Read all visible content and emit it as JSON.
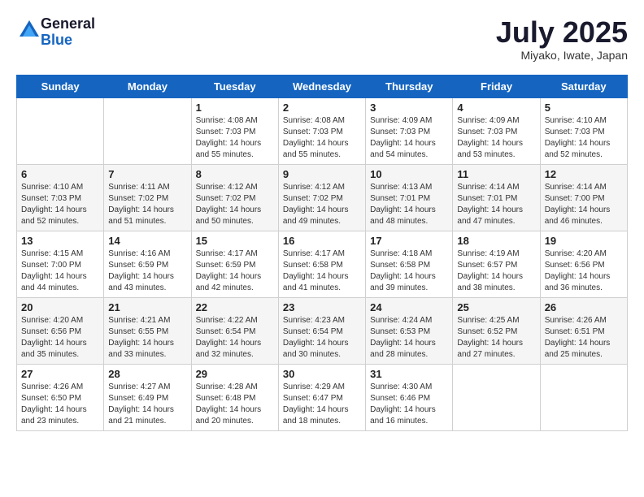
{
  "logo": {
    "general": "General",
    "blue": "Blue"
  },
  "title": "July 2025",
  "subtitle": "Miyako, Iwate, Japan",
  "headers": [
    "Sunday",
    "Monday",
    "Tuesday",
    "Wednesday",
    "Thursday",
    "Friday",
    "Saturday"
  ],
  "weeks": [
    [
      {
        "day": "",
        "sunrise": "",
        "sunset": "",
        "daylight": ""
      },
      {
        "day": "",
        "sunrise": "",
        "sunset": "",
        "daylight": ""
      },
      {
        "day": "1",
        "sunrise": "Sunrise: 4:08 AM",
        "sunset": "Sunset: 7:03 PM",
        "daylight": "Daylight: 14 hours and 55 minutes."
      },
      {
        "day": "2",
        "sunrise": "Sunrise: 4:08 AM",
        "sunset": "Sunset: 7:03 PM",
        "daylight": "Daylight: 14 hours and 55 minutes."
      },
      {
        "day": "3",
        "sunrise": "Sunrise: 4:09 AM",
        "sunset": "Sunset: 7:03 PM",
        "daylight": "Daylight: 14 hours and 54 minutes."
      },
      {
        "day": "4",
        "sunrise": "Sunrise: 4:09 AM",
        "sunset": "Sunset: 7:03 PM",
        "daylight": "Daylight: 14 hours and 53 minutes."
      },
      {
        "day": "5",
        "sunrise": "Sunrise: 4:10 AM",
        "sunset": "Sunset: 7:03 PM",
        "daylight": "Daylight: 14 hours and 52 minutes."
      }
    ],
    [
      {
        "day": "6",
        "sunrise": "Sunrise: 4:10 AM",
        "sunset": "Sunset: 7:03 PM",
        "daylight": "Daylight: 14 hours and 52 minutes."
      },
      {
        "day": "7",
        "sunrise": "Sunrise: 4:11 AM",
        "sunset": "Sunset: 7:02 PM",
        "daylight": "Daylight: 14 hours and 51 minutes."
      },
      {
        "day": "8",
        "sunrise": "Sunrise: 4:12 AM",
        "sunset": "Sunset: 7:02 PM",
        "daylight": "Daylight: 14 hours and 50 minutes."
      },
      {
        "day": "9",
        "sunrise": "Sunrise: 4:12 AM",
        "sunset": "Sunset: 7:02 PM",
        "daylight": "Daylight: 14 hours and 49 minutes."
      },
      {
        "day": "10",
        "sunrise": "Sunrise: 4:13 AM",
        "sunset": "Sunset: 7:01 PM",
        "daylight": "Daylight: 14 hours and 48 minutes."
      },
      {
        "day": "11",
        "sunrise": "Sunrise: 4:14 AM",
        "sunset": "Sunset: 7:01 PM",
        "daylight": "Daylight: 14 hours and 47 minutes."
      },
      {
        "day": "12",
        "sunrise": "Sunrise: 4:14 AM",
        "sunset": "Sunset: 7:00 PM",
        "daylight": "Daylight: 14 hours and 46 minutes."
      }
    ],
    [
      {
        "day": "13",
        "sunrise": "Sunrise: 4:15 AM",
        "sunset": "Sunset: 7:00 PM",
        "daylight": "Daylight: 14 hours and 44 minutes."
      },
      {
        "day": "14",
        "sunrise": "Sunrise: 4:16 AM",
        "sunset": "Sunset: 6:59 PM",
        "daylight": "Daylight: 14 hours and 43 minutes."
      },
      {
        "day": "15",
        "sunrise": "Sunrise: 4:17 AM",
        "sunset": "Sunset: 6:59 PM",
        "daylight": "Daylight: 14 hours and 42 minutes."
      },
      {
        "day": "16",
        "sunrise": "Sunrise: 4:17 AM",
        "sunset": "Sunset: 6:58 PM",
        "daylight": "Daylight: 14 hours and 41 minutes."
      },
      {
        "day": "17",
        "sunrise": "Sunrise: 4:18 AM",
        "sunset": "Sunset: 6:58 PM",
        "daylight": "Daylight: 14 hours and 39 minutes."
      },
      {
        "day": "18",
        "sunrise": "Sunrise: 4:19 AM",
        "sunset": "Sunset: 6:57 PM",
        "daylight": "Daylight: 14 hours and 38 minutes."
      },
      {
        "day": "19",
        "sunrise": "Sunrise: 4:20 AM",
        "sunset": "Sunset: 6:56 PM",
        "daylight": "Daylight: 14 hours and 36 minutes."
      }
    ],
    [
      {
        "day": "20",
        "sunrise": "Sunrise: 4:20 AM",
        "sunset": "Sunset: 6:56 PM",
        "daylight": "Daylight: 14 hours and 35 minutes."
      },
      {
        "day": "21",
        "sunrise": "Sunrise: 4:21 AM",
        "sunset": "Sunset: 6:55 PM",
        "daylight": "Daylight: 14 hours and 33 minutes."
      },
      {
        "day": "22",
        "sunrise": "Sunrise: 4:22 AM",
        "sunset": "Sunset: 6:54 PM",
        "daylight": "Daylight: 14 hours and 32 minutes."
      },
      {
        "day": "23",
        "sunrise": "Sunrise: 4:23 AM",
        "sunset": "Sunset: 6:54 PM",
        "daylight": "Daylight: 14 hours and 30 minutes."
      },
      {
        "day": "24",
        "sunrise": "Sunrise: 4:24 AM",
        "sunset": "Sunset: 6:53 PM",
        "daylight": "Daylight: 14 hours and 28 minutes."
      },
      {
        "day": "25",
        "sunrise": "Sunrise: 4:25 AM",
        "sunset": "Sunset: 6:52 PM",
        "daylight": "Daylight: 14 hours and 27 minutes."
      },
      {
        "day": "26",
        "sunrise": "Sunrise: 4:26 AM",
        "sunset": "Sunset: 6:51 PM",
        "daylight": "Daylight: 14 hours and 25 minutes."
      }
    ],
    [
      {
        "day": "27",
        "sunrise": "Sunrise: 4:26 AM",
        "sunset": "Sunset: 6:50 PM",
        "daylight": "Daylight: 14 hours and 23 minutes."
      },
      {
        "day": "28",
        "sunrise": "Sunrise: 4:27 AM",
        "sunset": "Sunset: 6:49 PM",
        "daylight": "Daylight: 14 hours and 21 minutes."
      },
      {
        "day": "29",
        "sunrise": "Sunrise: 4:28 AM",
        "sunset": "Sunset: 6:48 PM",
        "daylight": "Daylight: 14 hours and 20 minutes."
      },
      {
        "day": "30",
        "sunrise": "Sunrise: 4:29 AM",
        "sunset": "Sunset: 6:47 PM",
        "daylight": "Daylight: 14 hours and 18 minutes."
      },
      {
        "day": "31",
        "sunrise": "Sunrise: 4:30 AM",
        "sunset": "Sunset: 6:46 PM",
        "daylight": "Daylight: 14 hours and 16 minutes."
      },
      {
        "day": "",
        "sunrise": "",
        "sunset": "",
        "daylight": ""
      },
      {
        "day": "",
        "sunrise": "",
        "sunset": "",
        "daylight": ""
      }
    ]
  ]
}
